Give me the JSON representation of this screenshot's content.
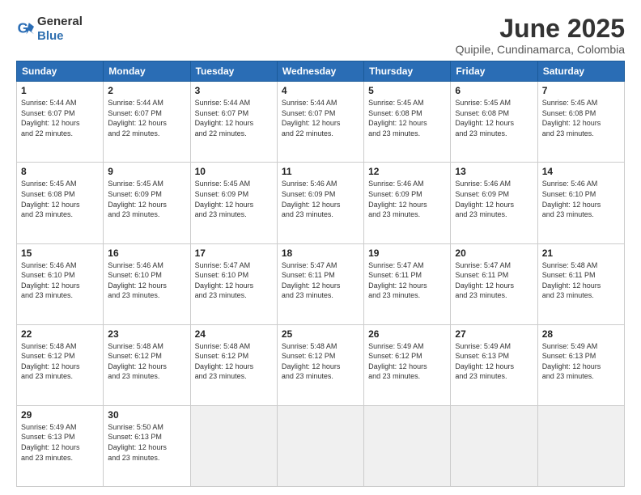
{
  "app": {
    "logo_general": "General",
    "logo_blue": "Blue",
    "title": "June 2025",
    "subtitle": "Quipile, Cundinamarca, Colombia"
  },
  "calendar": {
    "headers": [
      "Sunday",
      "Monday",
      "Tuesday",
      "Wednesday",
      "Thursday",
      "Friday",
      "Saturday"
    ],
    "rows": [
      [
        {
          "day": "1",
          "info": "Sunrise: 5:44 AM\nSunset: 6:07 PM\nDaylight: 12 hours\nand 22 minutes."
        },
        {
          "day": "2",
          "info": "Sunrise: 5:44 AM\nSunset: 6:07 PM\nDaylight: 12 hours\nand 22 minutes."
        },
        {
          "day": "3",
          "info": "Sunrise: 5:44 AM\nSunset: 6:07 PM\nDaylight: 12 hours\nand 22 minutes."
        },
        {
          "day": "4",
          "info": "Sunrise: 5:44 AM\nSunset: 6:07 PM\nDaylight: 12 hours\nand 22 minutes."
        },
        {
          "day": "5",
          "info": "Sunrise: 5:45 AM\nSunset: 6:08 PM\nDaylight: 12 hours\nand 23 minutes."
        },
        {
          "day": "6",
          "info": "Sunrise: 5:45 AM\nSunset: 6:08 PM\nDaylight: 12 hours\nand 23 minutes."
        },
        {
          "day": "7",
          "info": "Sunrise: 5:45 AM\nSunset: 6:08 PM\nDaylight: 12 hours\nand 23 minutes."
        }
      ],
      [
        {
          "day": "8",
          "info": "Sunrise: 5:45 AM\nSunset: 6:08 PM\nDaylight: 12 hours\nand 23 minutes."
        },
        {
          "day": "9",
          "info": "Sunrise: 5:45 AM\nSunset: 6:09 PM\nDaylight: 12 hours\nand 23 minutes."
        },
        {
          "day": "10",
          "info": "Sunrise: 5:45 AM\nSunset: 6:09 PM\nDaylight: 12 hours\nand 23 minutes."
        },
        {
          "day": "11",
          "info": "Sunrise: 5:46 AM\nSunset: 6:09 PM\nDaylight: 12 hours\nand 23 minutes."
        },
        {
          "day": "12",
          "info": "Sunrise: 5:46 AM\nSunset: 6:09 PM\nDaylight: 12 hours\nand 23 minutes."
        },
        {
          "day": "13",
          "info": "Sunrise: 5:46 AM\nSunset: 6:09 PM\nDaylight: 12 hours\nand 23 minutes."
        },
        {
          "day": "14",
          "info": "Sunrise: 5:46 AM\nSunset: 6:10 PM\nDaylight: 12 hours\nand 23 minutes."
        }
      ],
      [
        {
          "day": "15",
          "info": "Sunrise: 5:46 AM\nSunset: 6:10 PM\nDaylight: 12 hours\nand 23 minutes."
        },
        {
          "day": "16",
          "info": "Sunrise: 5:46 AM\nSunset: 6:10 PM\nDaylight: 12 hours\nand 23 minutes."
        },
        {
          "day": "17",
          "info": "Sunrise: 5:47 AM\nSunset: 6:10 PM\nDaylight: 12 hours\nand 23 minutes."
        },
        {
          "day": "18",
          "info": "Sunrise: 5:47 AM\nSunset: 6:11 PM\nDaylight: 12 hours\nand 23 minutes."
        },
        {
          "day": "19",
          "info": "Sunrise: 5:47 AM\nSunset: 6:11 PM\nDaylight: 12 hours\nand 23 minutes."
        },
        {
          "day": "20",
          "info": "Sunrise: 5:47 AM\nSunset: 6:11 PM\nDaylight: 12 hours\nand 23 minutes."
        },
        {
          "day": "21",
          "info": "Sunrise: 5:48 AM\nSunset: 6:11 PM\nDaylight: 12 hours\nand 23 minutes."
        }
      ],
      [
        {
          "day": "22",
          "info": "Sunrise: 5:48 AM\nSunset: 6:12 PM\nDaylight: 12 hours\nand 23 minutes."
        },
        {
          "day": "23",
          "info": "Sunrise: 5:48 AM\nSunset: 6:12 PM\nDaylight: 12 hours\nand 23 minutes."
        },
        {
          "day": "24",
          "info": "Sunrise: 5:48 AM\nSunset: 6:12 PM\nDaylight: 12 hours\nand 23 minutes."
        },
        {
          "day": "25",
          "info": "Sunrise: 5:48 AM\nSunset: 6:12 PM\nDaylight: 12 hours\nand 23 minutes."
        },
        {
          "day": "26",
          "info": "Sunrise: 5:49 AM\nSunset: 6:12 PM\nDaylight: 12 hours\nand 23 minutes."
        },
        {
          "day": "27",
          "info": "Sunrise: 5:49 AM\nSunset: 6:13 PM\nDaylight: 12 hours\nand 23 minutes."
        },
        {
          "day": "28",
          "info": "Sunrise: 5:49 AM\nSunset: 6:13 PM\nDaylight: 12 hours\nand 23 minutes."
        }
      ],
      [
        {
          "day": "29",
          "info": "Sunrise: 5:49 AM\nSunset: 6:13 PM\nDaylight: 12 hours\nand 23 minutes."
        },
        {
          "day": "30",
          "info": "Sunrise: 5:50 AM\nSunset: 6:13 PM\nDaylight: 12 hours\nand 23 minutes."
        },
        {
          "day": "",
          "info": ""
        },
        {
          "day": "",
          "info": ""
        },
        {
          "day": "",
          "info": ""
        },
        {
          "day": "",
          "info": ""
        },
        {
          "day": "",
          "info": ""
        }
      ]
    ]
  }
}
